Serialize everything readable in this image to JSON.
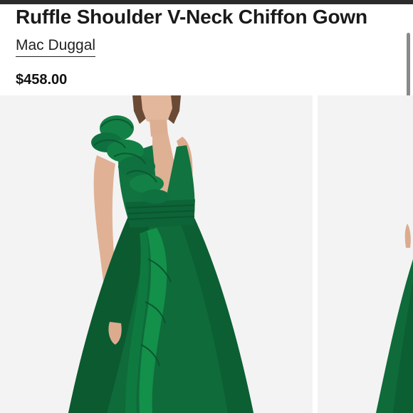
{
  "product": {
    "title": "Ruffle Shoulder V-Neck Chiffon Gown",
    "brand": "Mac Duggal",
    "price": "$458.00"
  },
  "gallery": {
    "images": [
      {
        "name": "gown-front-image"
      },
      {
        "name": "gown-side-image"
      }
    ]
  },
  "colors": {
    "gown": "#0f6b3a",
    "background": "#f3f3f3",
    "top_bar": "#2b2b2b"
  }
}
